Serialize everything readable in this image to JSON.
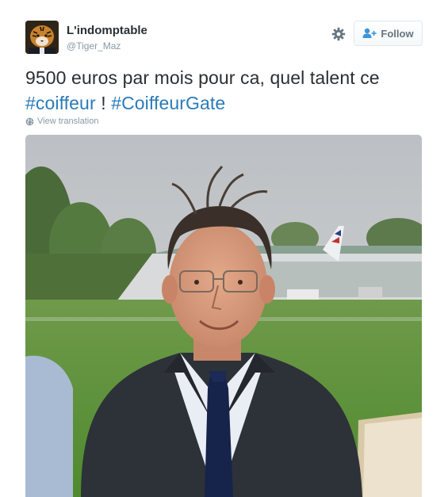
{
  "tweet": {
    "user": {
      "full_name": "L'indomptable",
      "screen_name": "@Tiger_Maz",
      "avatar_icon": "tiger-avatar"
    },
    "follow_button": {
      "label": "Follow",
      "icon": "add-user-icon"
    },
    "settings_icon": "gear-icon",
    "text_line1": "9500 euros par mois pour ca, quel talent ce",
    "hashtag1": "#coiffeur",
    "separator": " ! ",
    "hashtag2": "#CoiffeurGate",
    "translate_label": "View translation",
    "translate_icon": "globe-icon",
    "colors": {
      "link": "#2b7bb9",
      "text": "#292f33",
      "muted": "#8899a6"
    }
  }
}
